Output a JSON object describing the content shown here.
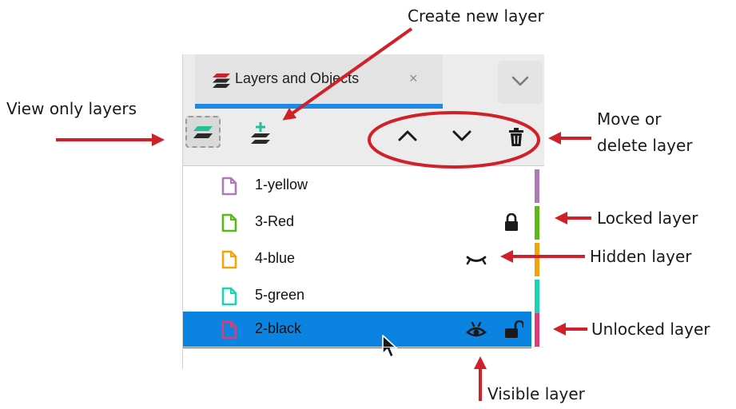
{
  "annotations": {
    "create_new_layer": "Create new layer",
    "view_only_layers": "View only layers",
    "move_or_delete_line1": "Move or",
    "move_or_delete_line2": "delete layer",
    "locked_layer": "Locked layer",
    "hidden_layer": "Hidden layer",
    "unlocked_layer": "Unlocked layer",
    "visible_layer": "Visible layer",
    "arrow_color": "#d0202a"
  },
  "tab": {
    "label": "Layers and Objects",
    "close_glyph": "×",
    "icon": "layers-icon"
  },
  "toolbar": {
    "buttons": [
      {
        "name": "view-only-layers-button",
        "icon": "layers-icon"
      },
      {
        "name": "create-layer-button",
        "icon": "add-layer-icon"
      },
      {
        "name": "move-up-button",
        "icon": "chevron-up-icon"
      },
      {
        "name": "move-down-button",
        "icon": "chevron-down-icon"
      },
      {
        "name": "delete-layer-button",
        "icon": "trash-icon"
      }
    ]
  },
  "layers": [
    {
      "name": "1-yellow",
      "color": "#b07ab8",
      "locked": false,
      "hidden": false,
      "selected": false
    },
    {
      "name": "3-Red",
      "color": "#5cb814",
      "locked": true,
      "hidden": false,
      "selected": false
    },
    {
      "name": "4-blue",
      "color": "#f5a30d",
      "locked": false,
      "hidden": true,
      "selected": false
    },
    {
      "name": "5-green",
      "color": "#18d4b4",
      "locked": false,
      "hidden": false,
      "selected": false
    },
    {
      "name": "2-black",
      "color": "#e03a7a",
      "locked": false,
      "hidden": false,
      "selected": true,
      "visible_icon": true,
      "unlocked_icon": true
    }
  ],
  "colors": {
    "selection": "#0a84e0",
    "tab_underline": "#1e88e5"
  }
}
